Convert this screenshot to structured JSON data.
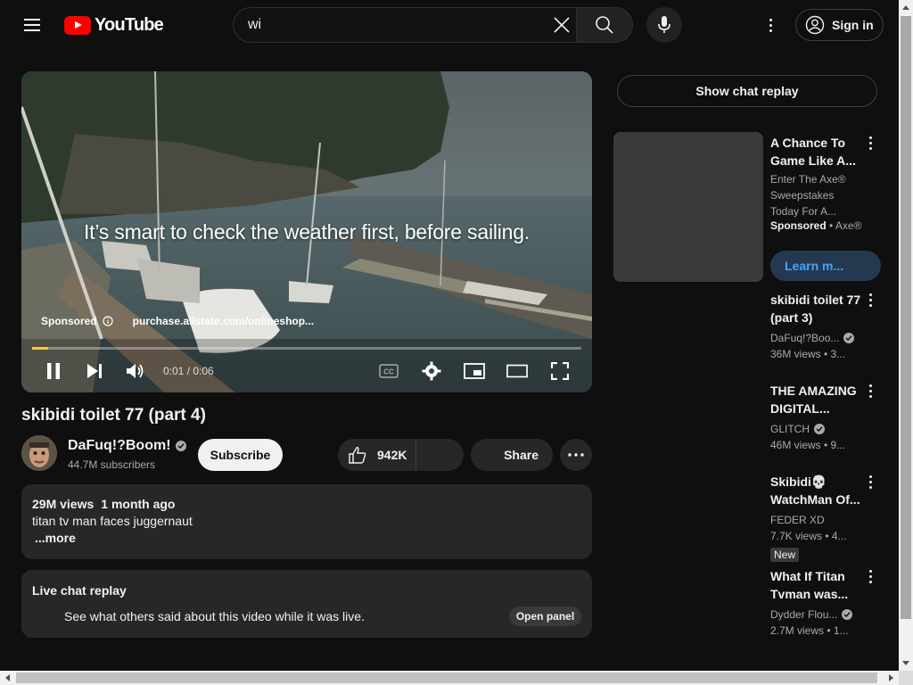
{
  "header": {
    "logo_text": "YouTube",
    "search_value": "wi",
    "signin_label": "Sign in"
  },
  "player": {
    "caption": "It’s smart to check the weather first, before sailing.",
    "sponsored_label": "Sponsored",
    "sponsor_url": "purchase.allstate.com/onlineshop...",
    "time_display": "0:01 / 0:06",
    "progress_fraction": 0.03,
    "accent_color": "#f7c948"
  },
  "video": {
    "title": "skibidi toilet 77 (part 4)",
    "channel": "DaFuq!?Boom!",
    "subscribers": "44.7M subscribers",
    "subscribe_label": "Subscribe",
    "likes": "942K",
    "share_label": "Share"
  },
  "description": {
    "views": "29M views",
    "age": "1 month ago",
    "text": "titan tv man faces juggernaut",
    "more_label": "...more"
  },
  "live_chat": {
    "title": "Live chat replay",
    "text": "See what others said about this video while it was live.",
    "open_label": "Open panel"
  },
  "sidebar": {
    "chat_replay_label": "Show chat replay",
    "ad": {
      "title": "A Chance To Game Like A...",
      "description": "Enter The Axe® Sweepstakes Today For A...",
      "sponsored": "Sponsored",
      "advertiser": "• Axe®",
      "cta": "Learn m..."
    },
    "recommendations": [
      {
        "title": "skibidi toilet 77 (part 3)",
        "channel": "DaFuq!?Boo...",
        "stats": "36M views • 3..."
      },
      {
        "title": "THE AMAZING DIGITAL...",
        "channel": "GLITCH",
        "stats": "46M views • 9..."
      },
      {
        "title": "Skibidi💀 WatchMan Of...",
        "channel": "FEDER XD",
        "stats": "7.7K views • 4...",
        "badge": "New"
      },
      {
        "title": "What If Titan Tvman was...",
        "channel": "Dydder Flou...",
        "stats": "2.7M views • 1..."
      }
    ]
  }
}
